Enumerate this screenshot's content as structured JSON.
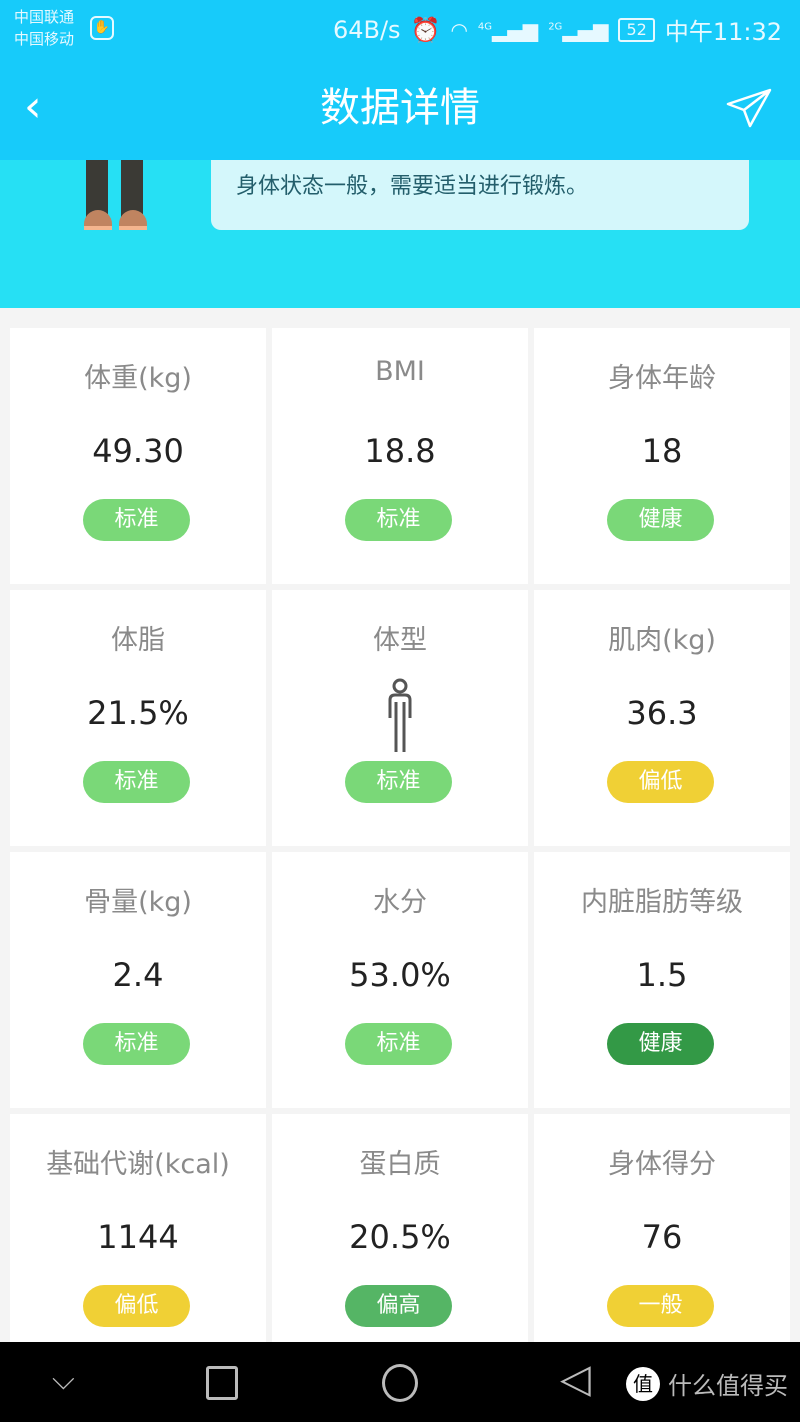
{
  "status": {
    "carrier1": "中国联通",
    "carrier2": "中国移动",
    "speed": "64B/s",
    "net1": "4G",
    "net2": "2G",
    "battery": "52",
    "time": "中午11:32"
  },
  "header": {
    "title": "数据详情"
  },
  "summary": {
    "text": "身体状态一般，需要适当进行锻炼。"
  },
  "colors": {
    "standard": "#7ad878",
    "low": "#f0d035",
    "healthy_dark": "#339946",
    "high": "#55b565",
    "accent": "#17cbfa"
  },
  "metrics": [
    {
      "label": "体重(kg)",
      "value": "49.30",
      "badge": "标准",
      "badge_color": "#7ad878"
    },
    {
      "label": "BMI",
      "value": "18.8",
      "badge": "标准",
      "badge_color": "#7ad878"
    },
    {
      "label": "身体年龄",
      "value": "18",
      "badge": "健康",
      "badge_color": "#7ad878"
    },
    {
      "label": "体脂",
      "value": "21.5%",
      "badge": "标准",
      "badge_color": "#7ad878"
    },
    {
      "label": "体型",
      "value": null,
      "icon": "body-figure-icon",
      "badge": "标准",
      "badge_color": "#7ad878"
    },
    {
      "label": "肌肉(kg)",
      "value": "36.3",
      "badge": "偏低",
      "badge_color": "#f0d035"
    },
    {
      "label": "骨量(kg)",
      "value": "2.4",
      "badge": "标准",
      "badge_color": "#7ad878"
    },
    {
      "label": "水分",
      "value": "53.0%",
      "badge": "标准",
      "badge_color": "#7ad878"
    },
    {
      "label": "内脏脂肪等级",
      "value": "1.5",
      "badge": "健康",
      "badge_color": "#339946"
    },
    {
      "label": "基础代谢(kcal)",
      "value": "1144",
      "badge": "偏低",
      "badge_color": "#f0d035"
    },
    {
      "label": "蛋白质",
      "value": "20.5%",
      "badge": "偏高",
      "badge_color": "#55b565"
    },
    {
      "label": "身体得分",
      "value": "76",
      "badge": "一般",
      "badge_color": "#f0d035"
    }
  ],
  "watermark": {
    "logo": "值",
    "text": "什么值得买"
  }
}
